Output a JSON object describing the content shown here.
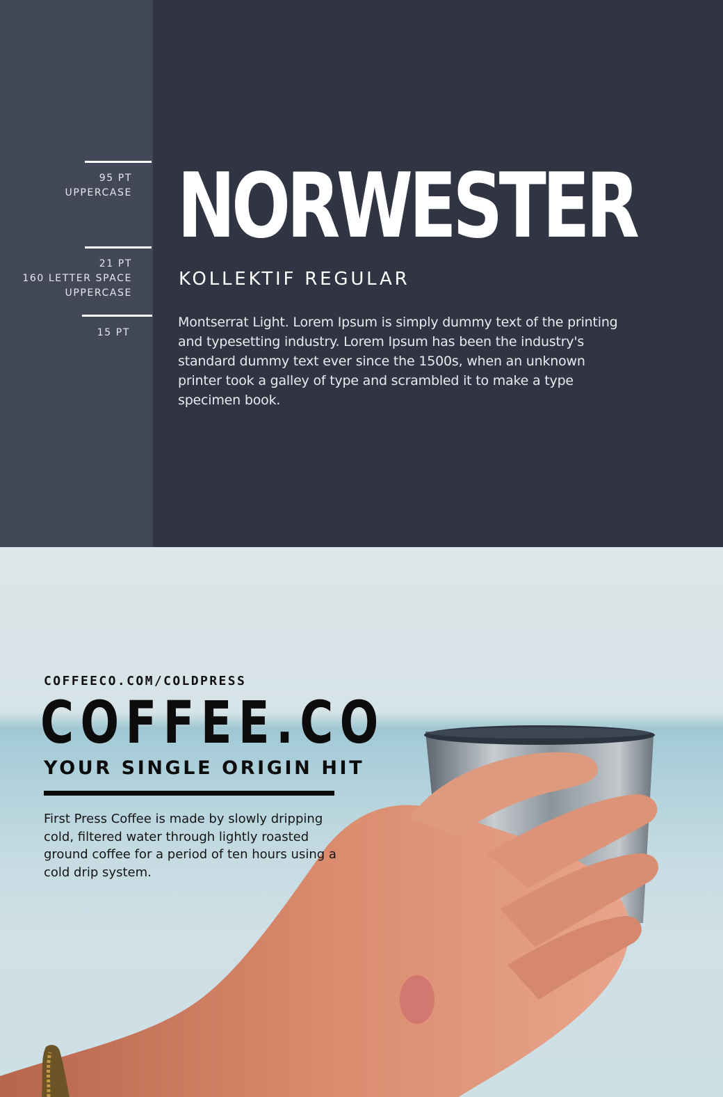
{
  "specimen": {
    "specs": [
      {
        "lines": [
          "95 PT",
          "UPPERCASE"
        ]
      },
      {
        "lines": [
          "21 PT",
          "160 LETTER SPACE",
          "UPPERCASE"
        ]
      },
      {
        "lines": [
          "15 PT"
        ]
      }
    ],
    "display_title": "NORWESTER",
    "subheading": "KOLLEKTIF REGULAR",
    "body_text": "Montserrat Light. Lorem Ipsum is simply dummy text of the printing and typesetting industry. Lorem Ipsum has been the industry's standard dummy text ever since the 1500s, when an unknown printer took a galley of type and scrambled it to make a type specimen book."
  },
  "ad": {
    "url": "COFFEECO.COM/COLDPRESS",
    "brand": "COFFEE.CO",
    "tagline": "YOUR SINGLE ORIGIN HIT",
    "description": "First Press Coffee is made by slowly dripping cold, filtered water through lightly roasted ground coffee for a period of ten hours using a cold drip system."
  },
  "colors": {
    "panel_dark": "#313543",
    "sidebar": "#434858",
    "white": "#ffffff",
    "ink": "#0c0c0c"
  }
}
